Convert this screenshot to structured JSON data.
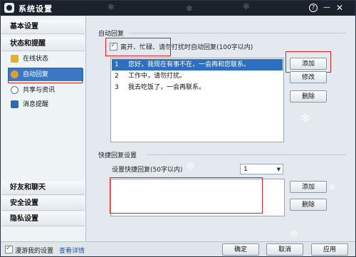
{
  "window": {
    "title": "系统设置",
    "help_glyph": "?",
    "min_glyph": "—",
    "close_glyph": "✕"
  },
  "sidebar": {
    "basic": "基本设置",
    "status": "状态和提醒",
    "items": [
      {
        "label": "在线状态",
        "icon": "online-status-icon",
        "color": "#e8b020"
      },
      {
        "label": "自动回复",
        "icon": "auto-reply-icon",
        "color": "#e0a030",
        "selected": true
      },
      {
        "label": "共享与资讯",
        "icon": "share-info-icon",
        "color": "#3a78c3"
      },
      {
        "label": "消息提醒",
        "icon": "message-alert-icon",
        "color": "#2a6ab0"
      }
    ],
    "friends_chat": "好友和聊天",
    "security": "安全设置",
    "privacy": "隐私设置"
  },
  "auto_reply": {
    "section_title": "自动回复",
    "checkbox_label": "离开、忙碌、请勿打扰时自动回复(100字以内)",
    "checked": true,
    "messages": [
      {
        "num": "1",
        "text": "您好，我现在有事不在，一会再和您联系。"
      },
      {
        "num": "2",
        "text": "工作中，请勿打扰。"
      },
      {
        "num": "3",
        "text": "我去吃饭了，一会再联系。"
      }
    ],
    "add_label": "添加",
    "edit_label": "修改",
    "delete_label": "删除"
  },
  "quick_reply": {
    "section_title": "快捷回复设置",
    "setting_label": "设置快捷回复(50字以内)",
    "select_value": "1",
    "select_arrow": "▼",
    "add_label": "添加",
    "delete_label": "删除"
  },
  "footer": {
    "roam_checkbox_label": "漫游我的设置",
    "roam_checked": true,
    "details_link": "查看详情",
    "ok_label": "确定",
    "cancel_label": "取消",
    "apply_label": "应用"
  },
  "colors": {
    "accent": "#2f6fc0",
    "titlebar": "#1b222c",
    "annotation_red": "#e02020"
  }
}
